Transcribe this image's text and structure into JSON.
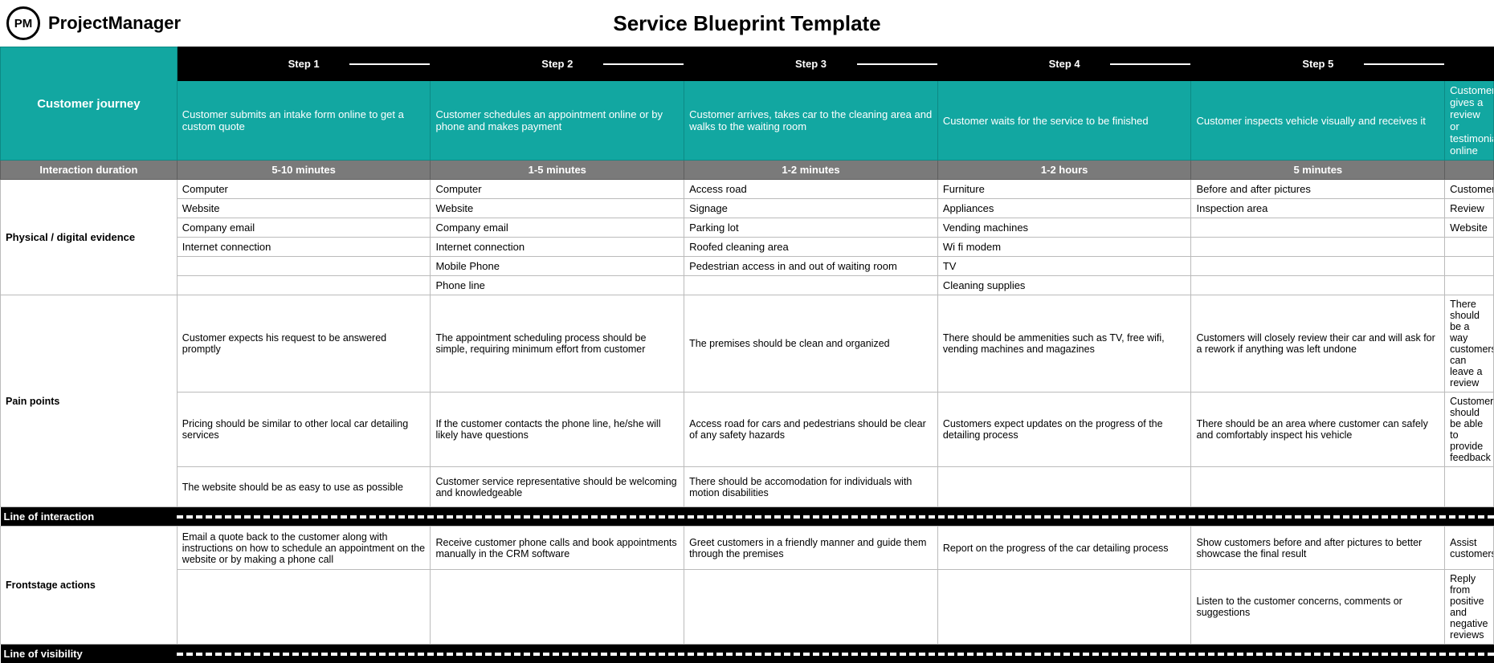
{
  "brand": {
    "logo_text": "PM",
    "name": "ProjectManager"
  },
  "title": "Service Blueprint Template",
  "labels": {
    "journey": "Customer journey",
    "duration": "Interaction duration",
    "evidence": "Physical / digital evidence",
    "pain": "Pain points",
    "frontstage": "Frontstage actions",
    "sep_interaction": "Line of interaction",
    "sep_visibility": "Line of visibility"
  },
  "steps": [
    {
      "n": "Step 1",
      "desc": "Customer submits an intake form online  to get a custom quote",
      "dur": "5-10 minutes"
    },
    {
      "n": "Step 2",
      "desc": "Customer schedules an appointment online or by phone and makes payment",
      "dur": "1-5 minutes"
    },
    {
      "n": "Step 3",
      "desc": "Customer arrives, takes car to the cleaning area and walks to the waiting room",
      "dur": "1-2 minutes"
    },
    {
      "n": "Step 4",
      "desc": "Customer waits for the service to be finished",
      "dur": "1-2 hours"
    },
    {
      "n": "Step 5",
      "desc": "Customer inspects vehicle visually and receives it",
      "dur": "5 minutes"
    },
    {
      "n": "",
      "desc": "Customer gives a review or testimonial online",
      "dur": ""
    }
  ],
  "evidence": [
    [
      "Computer",
      "Computer",
      "Access road",
      "Furniture",
      "Before and after pictures",
      "Customer"
    ],
    [
      "Website",
      "Website",
      "Signage",
      "Appliances",
      "Inspection area",
      "Review"
    ],
    [
      "Company email",
      "Company email",
      "Parking lot",
      "Vending machines",
      "",
      "Website"
    ],
    [
      "Internet connection",
      "Internet connection",
      "Roofed cleaning area",
      "Wi fi modem",
      "",
      ""
    ],
    [
      "",
      "Mobile Phone",
      "Pedestrian access in and out of waiting room",
      "TV",
      "",
      ""
    ],
    [
      "",
      "Phone line",
      "",
      "Cleaning supplies",
      "",
      ""
    ]
  ],
  "pain": [
    [
      "Customer expects his request to be answered promptly",
      "The appointment scheduling process should be simple, requiring minimum effort from customer",
      "The premises should be clean and organized",
      "There should be ammenities such as TV, free wifi, vending machines and magazines",
      "Customers will closely review their car and will ask for a rework if anything was left undone",
      "There should be a way customers can leave a review"
    ],
    [
      "Pricing should be similar to other local car detailing services",
      "If the customer contacts the phone line, he/she will likely have questions",
      "Access road for cars and pedestrians should be clear of any safety hazards",
      "Customers expect updates on the progress of the detailing process",
      "There should be an area where customer can safely and comfortably inspect his vehicle",
      "Customers should be able to provide feedback"
    ],
    [
      "The website should be as easy to use as possible",
      "Customer service representative should be welcoming and knowledgeable",
      "There should be accomodation for individuals with motion disabilities",
      "",
      "",
      ""
    ]
  ],
  "frontstage": [
    [
      "Email a quote back to the customer along with instructions on how to schedule an appointment on the website or by making a phone call",
      "Receive customer phone calls and book appointments manually in the CRM software",
      "Greet customers in a friendly manner and guide them through the premises",
      "Report on the progress of the car detailing process",
      "Show customers before and after pictures to better showcase the final result",
      "Assist customers"
    ],
    [
      "",
      "",
      "",
      "",
      "Listen to the customer concerns, comments or suggestions",
      "Reply from positive and negative reviews"
    ]
  ]
}
